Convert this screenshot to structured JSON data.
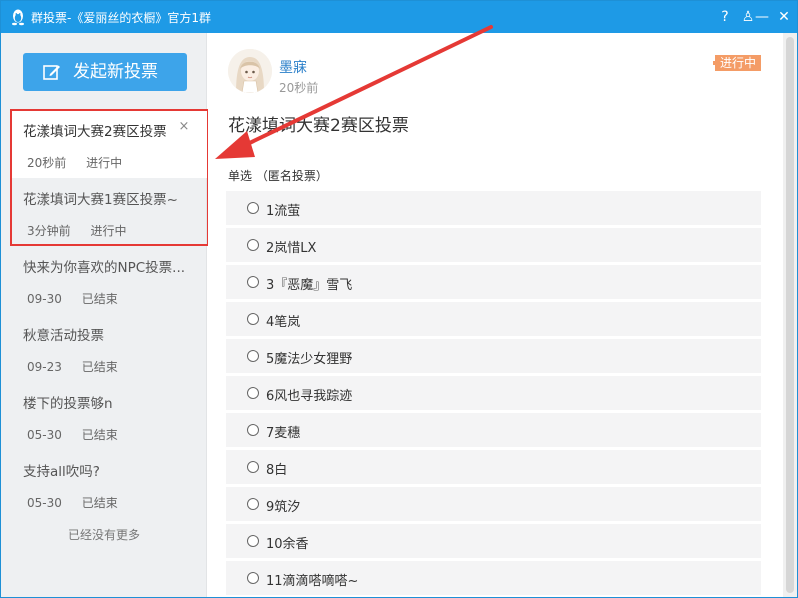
{
  "window": {
    "title": "群投票-《爱丽丝的衣橱》官方1群",
    "help_glyph": "?",
    "shirt_glyph": "♙",
    "minimize_glyph": "—",
    "close_glyph": "✕"
  },
  "sidebar": {
    "new_vote_label": "发起新投票",
    "items": [
      {
        "title": "花漾填词大赛2赛区投票",
        "time": "20秒前",
        "status": "进行中",
        "close": "×"
      },
      {
        "title": "花漾填词大赛1赛区投票~",
        "time": "3分钟前",
        "status": "进行中"
      },
      {
        "title": "快来为你喜欢的NPC投票...",
        "time": "09-30",
        "status": "已结束"
      },
      {
        "title": "秋意活动投票",
        "time": "09-23",
        "status": "已结束"
      },
      {
        "title": "楼下的投票够n",
        "time": "05-30",
        "status": "已结束"
      },
      {
        "title": "支持all吹吗?",
        "time": "05-30",
        "status": "已结束"
      }
    ],
    "no_more": "已经没有更多"
  },
  "main": {
    "author": "墨寐",
    "post_time": "20秒前",
    "status_badge": "进行中",
    "title": "花漾填词大赛2赛区投票",
    "vote_type": "单选 （匿名投票）",
    "options": [
      "1流萤",
      "2岚惜LX",
      "3『恶魔』雪飞",
      "4笔岚",
      "5魔法少女狸野",
      "6风也寻我踪迹",
      "7麦穗",
      "8白",
      "9筑汐",
      "10余香",
      "11滴滴嗒嘀嗒~"
    ]
  },
  "colors": {
    "titlebar": "#1e9ae6",
    "button": "#3da4ea",
    "highlight_box": "#e53935",
    "status_badge": "#f49c66",
    "author_link": "#2a7fc9"
  }
}
